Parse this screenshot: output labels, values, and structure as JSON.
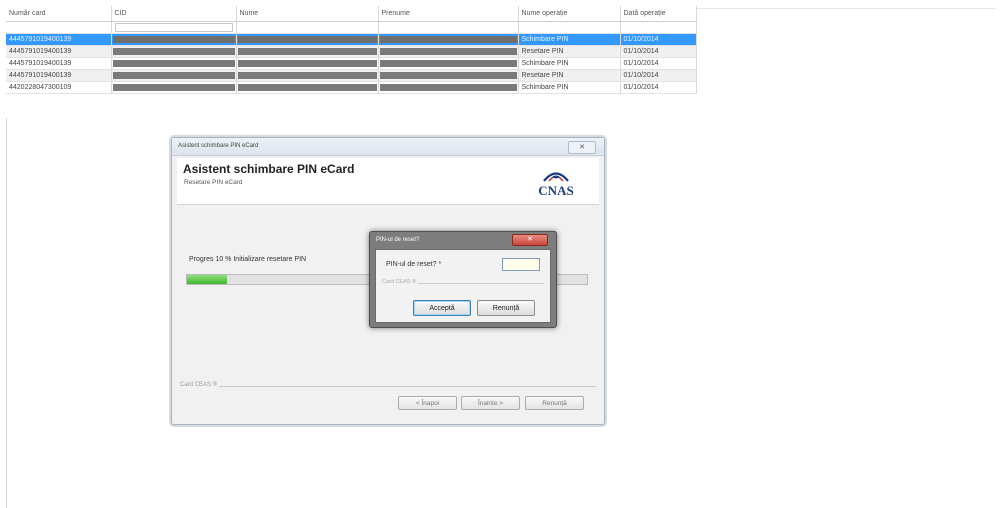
{
  "grid": {
    "columns": [
      "Număr card",
      "CID",
      "Nume",
      "Prenume",
      "Nume operație",
      "Dată operație"
    ],
    "rows": [
      {
        "card": "444579101940013​9",
        "operation": "Schimbare PIN",
        "date": "01/10/2014"
      },
      {
        "card": "4445791019400139",
        "operation": "Resetare PIN",
        "date": "01/10/2014"
      },
      {
        "card": "4445791019400139",
        "operation": "Schimbare PIN",
        "date": "01/10/2014"
      },
      {
        "card": "4445791019400139",
        "operation": "Resetare PIN",
        "date": "01/10/2014"
      },
      {
        "card": "4420228047300109",
        "operation": "Schimbare PIN",
        "date": "01/10/2014"
      }
    ],
    "selected_row": 0
  },
  "wizard": {
    "window_title": "Asistent schimbare PIN eCard",
    "close_glyph": "✕",
    "header_title": "Asistent schimbare PIN eCard",
    "header_subtitle": "Resetare PIN eCard",
    "logo_text": "CNAS",
    "progress_label": "Progres 10 % Initializare resetare PIN",
    "progress_percent": 10,
    "group_label": "Card CEAS ®",
    "back_button": "< Înapoi",
    "next_button": "Înainte >",
    "cancel_button": "Renunță"
  },
  "dialog": {
    "title": "PIN-ul de reset?",
    "close_glyph": "✕",
    "field_label": "PIN-ul de reset? *",
    "field_value": "",
    "group_label": "Card CEAS ®",
    "accept_button": "Acceptă",
    "cancel_button": "Renunță"
  },
  "colors": {
    "selection": "#3399ff",
    "progress": "#3fb82c",
    "logo": "#1c3f82"
  }
}
